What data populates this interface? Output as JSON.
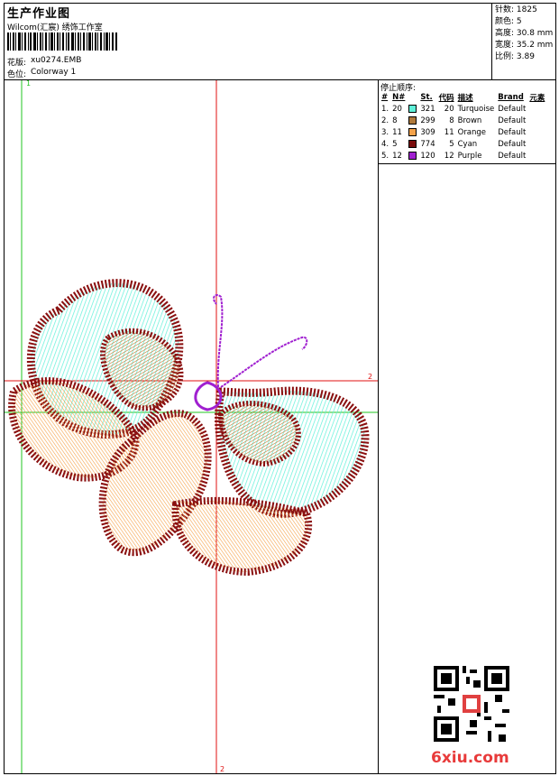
{
  "header": {
    "title": "生产作业图",
    "company": "Wilcom(汇宸) 绣饰工作室",
    "design_label": "花版:",
    "design_value": "xu0274.EMB",
    "colorway_label": "色位:",
    "colorway_value": "Colorway 1"
  },
  "specs": {
    "stitches": "针数: 1825",
    "colors": "颜色: 5",
    "height": "高度: 30.8 mm",
    "width": "宽度: 35.2 mm",
    "ratio": "比例: 3.89"
  },
  "stop_sequence": {
    "heading": "停止顺序:",
    "columns": [
      "#",
      "N#",
      "St.",
      "代码",
      "描述",
      "Brand",
      "元素"
    ],
    "rows": [
      {
        "idx": "1.",
        "n": "20",
        "color": "#5ff0d8",
        "st": "321",
        "code": "20",
        "desc": "Turquoise",
        "brand": "Default"
      },
      {
        "idx": "2.",
        "n": "8",
        "color": "#b07a3c",
        "st": "299",
        "code": "8",
        "desc": "Brown",
        "brand": "Default"
      },
      {
        "idx": "3.",
        "n": "11",
        "color": "#f4a24a",
        "st": "309",
        "code": "11",
        "desc": "Orange",
        "brand": "Default"
      },
      {
        "idx": "4.",
        "n": "5",
        "color": "#7a0c0c",
        "st": "774",
        "code": "5",
        "desc": "Cyan",
        "brand": "Default"
      },
      {
        "idx": "5.",
        "n": "12",
        "color": "#a020d0",
        "st": "120",
        "code": "12",
        "desc": "Purple",
        "brand": "Default"
      }
    ]
  },
  "canvas": {
    "axis_labels": {
      "top_green": "1",
      "right_red": "2",
      "bottom_red": "2"
    },
    "axis_colors": {
      "green": "#22c422",
      "red": "#e01010"
    }
  },
  "watermark": {
    "site": "6xiu.com",
    "qr_label_icon": "qr-code-icon"
  }
}
